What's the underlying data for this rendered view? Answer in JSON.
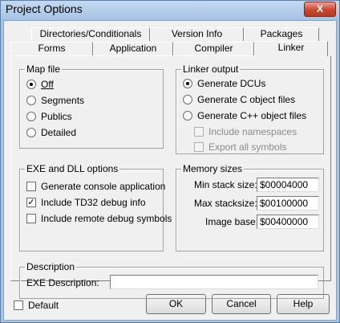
{
  "window": {
    "title": "Project Options",
    "close_label": "X"
  },
  "tabs_back": [
    "Directories/Conditionals",
    "Version Info",
    "Packages"
  ],
  "tabs_front": [
    "Forms",
    "Application",
    "Compiler",
    "Linker"
  ],
  "map_file": {
    "label": "Map file",
    "options": [
      "Off",
      "Segments",
      "Publics",
      "Detailed"
    ],
    "selected": "Off"
  },
  "linker_output": {
    "label": "Linker output",
    "options": [
      "Generate DCUs",
      "Generate C object files",
      "Generate C++ object files"
    ],
    "selected": "Generate DCUs",
    "sub_options": [
      "Include namespaces",
      "Export all symbols"
    ]
  },
  "exe_dll": {
    "label": "EXE and DLL options",
    "options": [
      {
        "label": "Generate console application",
        "checked": false
      },
      {
        "label": "Include TD32 debug info",
        "checked": true
      },
      {
        "label": "Include remote debug symbols",
        "checked": false
      }
    ]
  },
  "memory": {
    "label": "Memory sizes",
    "min_stack_label": "Min stack size:",
    "min_stack_value": "$00004000",
    "max_stack_label": "Max stacksize:",
    "max_stack_value": "$00100000",
    "image_base_label": "Image base:",
    "image_base_value": "$00400000"
  },
  "description": {
    "label": "Description",
    "exe_desc_label": "EXE Description:",
    "exe_desc_value": ""
  },
  "footer": {
    "default_label": "Default",
    "ok_label": "OK",
    "cancel_label": "Cancel",
    "help_label": "Help"
  }
}
